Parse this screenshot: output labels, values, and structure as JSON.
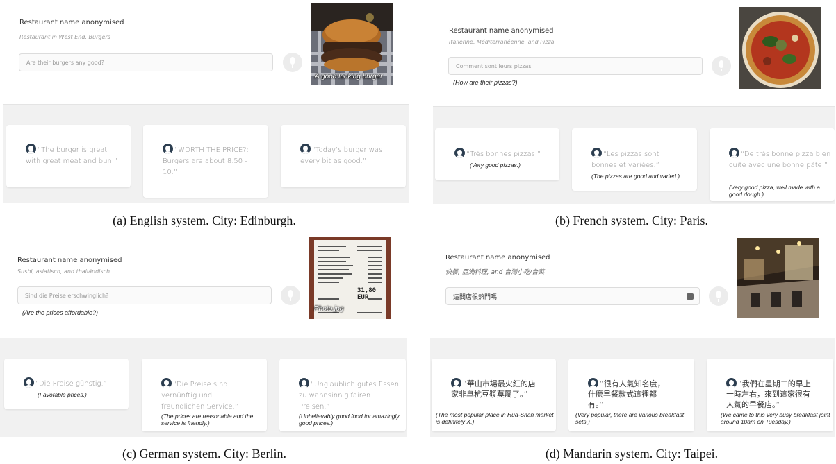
{
  "panels": {
    "a": {
      "restaurant_name": "Restaurant name anonymised",
      "subtitle_prefix": "Restaurant in West End. ",
      "subtitle_cuisine": "Burgers",
      "query_placeholder": "Are their burgers any good?",
      "photo_caption": "A good looking burger",
      "reviews": [
        {
          "text": "“The burger is great with great meat and bun.”"
        },
        {
          "text": "“WORTH THE PRICE?: Burgers are about 8.50 - 10.”"
        },
        {
          "text": "“Today’s burger was every bit as good.”"
        }
      ],
      "caption": "(a) English system. City: Edinburgh."
    },
    "b": {
      "restaurant_name": "Restaurant name anonymised",
      "subtitle": "Italienne, Méditerranéenne, and Pizza",
      "query_placeholder": "Comment sont leurs pizzas",
      "query_translation": "(How are their pizzas?)",
      "reviews": [
        {
          "text": "“Très bonnes pizzas.”",
          "translation": "(Very good pizzas.)"
        },
        {
          "text": "“Les pizzas sont bonnes et variées.”",
          "translation": "(The pizzas are good and varied.)"
        },
        {
          "text": "“De très bonne pizza bien cuite avec une bonne pâte.”",
          "translation": "(Very good pizza, well made with a good dough.)"
        }
      ],
      "caption": "(b) French system. City: Paris."
    },
    "c": {
      "restaurant_name": "Restaurant name anonymised",
      "subtitle": "Sushi, asiatisch, and thailändisch",
      "query_placeholder": "Sind die Preise erschwinglich?",
      "query_translation": "(Are the prices affordable?)",
      "receipt_total": "31,80 EUR",
      "photo_caption": "Photo.jpg",
      "reviews": [
        {
          "text": "“Die Preise günstig.”",
          "translation": "(Favorable prices.)"
        },
        {
          "text": "“Die Preise sind vernünftig und freundlichen Service.”",
          "translation": "(The prices are reasonable and the service is friendly.)"
        },
        {
          "text": "“Unglaublich gutes Essen zu wahnsinnig fairen Preisen.”",
          "translation": "(Unbelievably good food for amazingly good prices.)"
        }
      ],
      "caption": "(c) German system. City: Berlin."
    },
    "d": {
      "restaurant_name": "Restaurant name anonymised",
      "subtitle": "快餐, 亞洲料理, and 台灣小吃/台菜",
      "query_value": "這間店很熱門嗎",
      "reviews": [
        {
          "text": "“華山市場最火紅的店家非阜杭豆漿莫屬了。”",
          "translation": "(The most popular place in Hua-Shan market is definitely X.)"
        },
        {
          "text": "“很有人氣知名度，什麼早餐款式這裡都有。”",
          "translation": "(Very popular, there are various breakfast sets.)"
        },
        {
          "text": "“我們在星期二的早上十時左右，來到這家很有人氣的早餐店。”",
          "translation": "(We came to this very busy breakfast joint around 10am on Tuesday.)"
        }
      ],
      "caption": "(d) Mandarin system. City: Taipei."
    }
  },
  "colors": {
    "avatar": "#2c3e50",
    "panel_gray": "#f1f1f1"
  },
  "icons": {
    "reviewer": "user-avatar-icon",
    "microphone": "microphone-icon",
    "keyboard": "keyboard-icon"
  }
}
